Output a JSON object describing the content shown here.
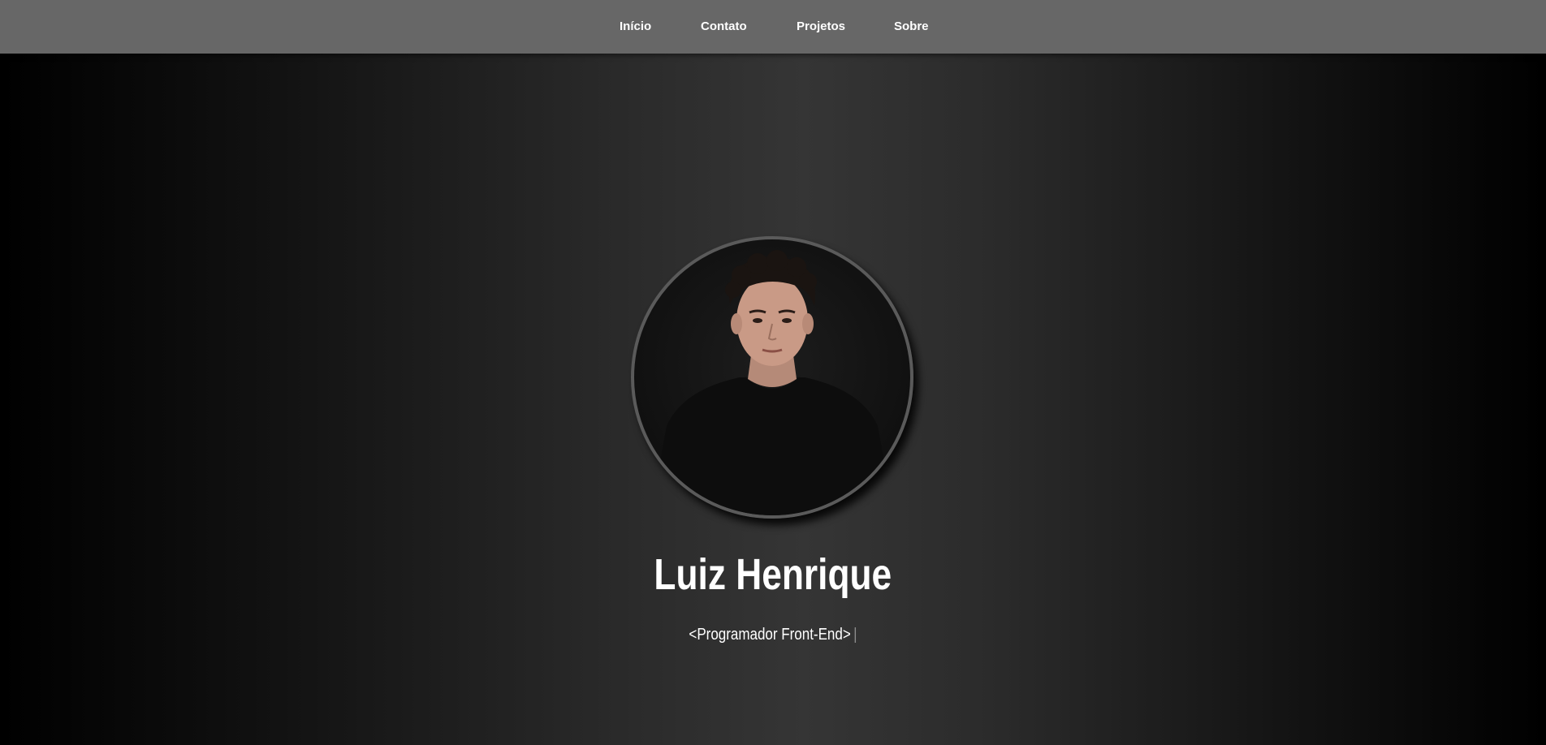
{
  "nav": {
    "items": [
      {
        "label": "Início"
      },
      {
        "label": "Contato"
      },
      {
        "label": "Projetos"
      },
      {
        "label": "Sobre"
      }
    ]
  },
  "hero": {
    "avatar_icon": "profile-photo",
    "name": "Luiz Henrique",
    "role": "<Programador Front-End>",
    "cursor": "|"
  },
  "colors": {
    "navbar": "#676767",
    "text": "#ffffff",
    "cursor": "#8c8c8c",
    "background_center": "#353535",
    "background_edge": "#000000"
  }
}
